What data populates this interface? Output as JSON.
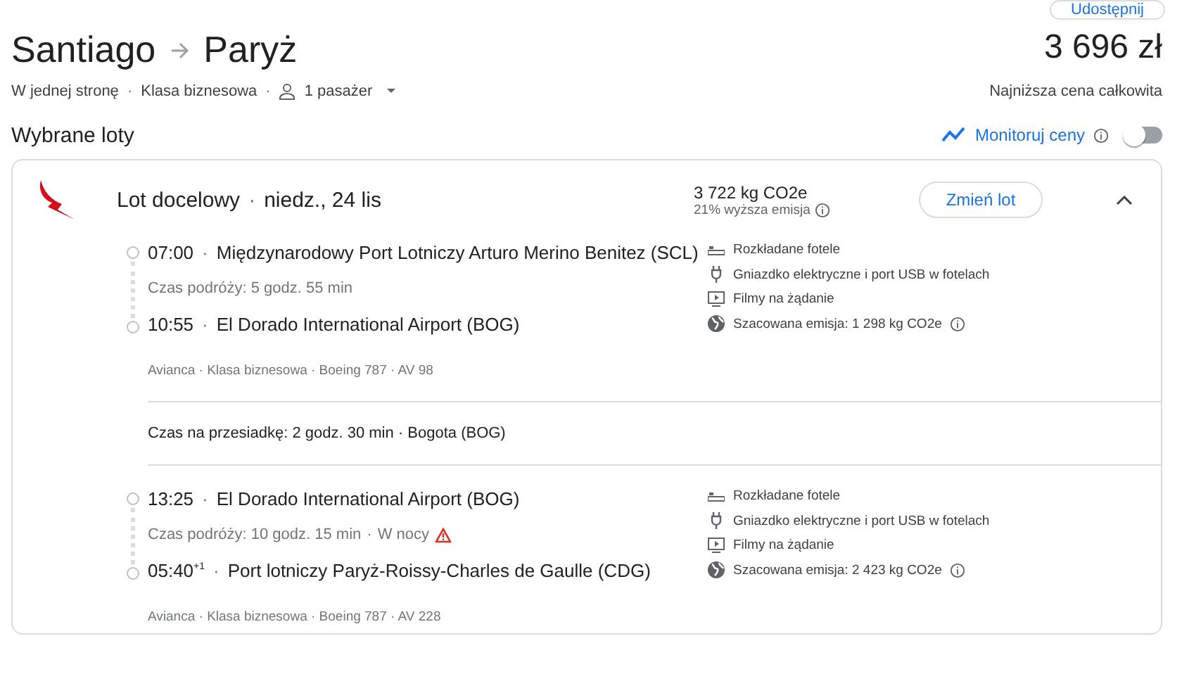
{
  "share_button": {
    "label": "Udostępnij"
  },
  "route": {
    "origin": "Santiago",
    "destination": "Paryż"
  },
  "price": {
    "amount": "3 696 zł",
    "caption": "Najniższa cena całkowita"
  },
  "separator": "·",
  "trip_options": {
    "trip_type": "W jednej stronę",
    "cabin_class": "Klasa biznesowa",
    "passengers": "1 pasażer"
  },
  "section_title": "Wybrane loty",
  "price_tracking": {
    "label": "Monitoruj ceny",
    "on": false
  },
  "flight": {
    "title": "Lot docelowy",
    "date": "niedz., 24 lis",
    "emissions": "3 722 kg CO2e",
    "emissions_note": "21% wyższa emisja",
    "change_button": "Zmień lot",
    "expanded": true,
    "legs": [
      {
        "departure_time": "07:00",
        "departure_airport": "Międzynarodowy Port Lotniczy Arturo Merino Benitez (SCL)",
        "duration": "Czas podróży: 5 godz. 55 min",
        "overnight": false,
        "arrival_time": "10:55",
        "arrival_airport": "El Dorado International Airport (BOG)",
        "details": "Avianca · Klasa biznesowa · Boeing 787 · AV 98",
        "amenities": [
          {
            "kind": "seat",
            "label": "Rozkładane fotele"
          },
          {
            "kind": "power",
            "label": "Gniazdko elektryczne i port USB w fotelach"
          },
          {
            "kind": "video",
            "label": "Filmy na żądanie"
          },
          {
            "kind": "emission",
            "label": "Szacowana emisja: 1 298 kg CO2e"
          }
        ]
      },
      {
        "departure_time": "13:25",
        "departure_airport": "El Dorado International Airport (BOG)",
        "duration": "Czas podróży: 10 godz. 15 min",
        "overnight": true,
        "overnight_label": "W nocy",
        "arrival_time": "05:40",
        "day_offset": "+1",
        "arrival_airport": "Port lotniczy Paryż-Roissy-Charles de Gaulle (CDG)",
        "details": "Avianca · Klasa biznesowa · Boeing 787 · AV 228",
        "amenities": [
          {
            "kind": "seat",
            "label": "Rozkładane fotele"
          },
          {
            "kind": "power",
            "label": "Gniazdko elektryczne i port USB w fotelach"
          },
          {
            "kind": "video",
            "label": "Filmy na żądanie"
          },
          {
            "kind": "emission",
            "label": "Szacowana emisja: 2 423 kg CO2e"
          }
        ]
      }
    ],
    "layovers": [
      "Czas na przesiadkę: 2 godz. 30 min · Bogota (BOG)"
    ]
  }
}
